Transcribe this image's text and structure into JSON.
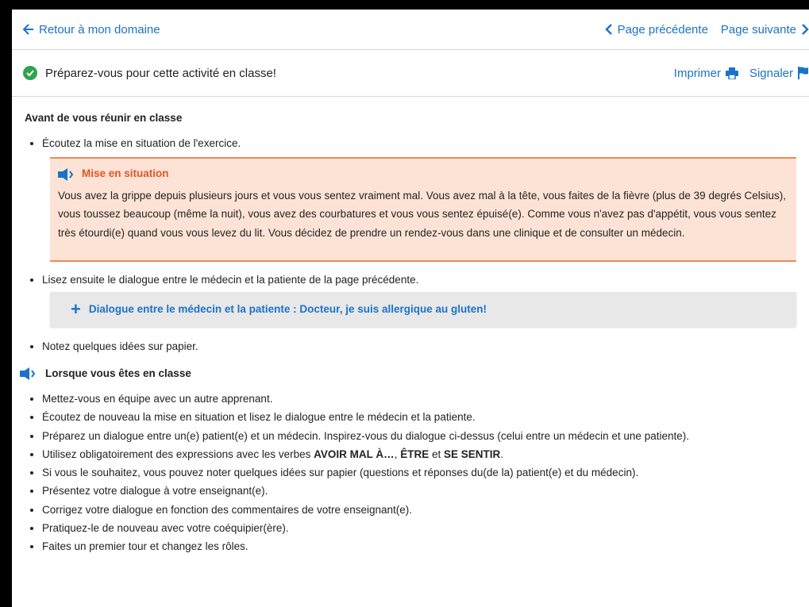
{
  "nav": {
    "back_label": "Retour à mon domaine",
    "prev_label": "Page précédente",
    "next_label": "Page suivante"
  },
  "toolbar": {
    "status_text": "Préparez-vous pour cette activité en classe!",
    "print_label": "Imprimer",
    "report_label": "Signaler"
  },
  "section1": {
    "title": "Avant de vous réunir en classe",
    "item1": "Écoutez la mise en situation de l'exercice.",
    "situation_title": "Mise en situation",
    "situation_text": "Vous avez la grippe depuis plusieurs jours et vous vous sentez vraiment mal. Vous avez mal à la tête, vous faites de la fièvre (plus de 39 degrés Celsius), vous toussez beaucoup (même la nuit), vous avez des courbatures et vous vous sentez épuisé(e). Comme vous n'avez pas d'appétit, vous vous sentez très étourdi(e) quand vous vous levez du lit. Vous décidez de prendre un rendez-vous dans une clinique et de consulter un médecin.",
    "item2": "Lisez ensuite le dialogue entre le médecin et la patiente de la page précédente.",
    "accordion_label": "Dialogue entre le médecin et la patiente : Docteur, je suis allergique au gluten!",
    "item3": "Notez quelques idées sur papier."
  },
  "section2": {
    "title": "Lorsque vous êtes en classe",
    "items": [
      "Mettez-vous en équipe avec un autre apprenant.",
      "Écoutez de nouveau la mise en situation et lisez le dialogue entre le médecin et la patiente.",
      "Préparez un dialogue entre un(e) patient(e) et un médecin. Inspirez-vous du dialogue ci-dessus (celui entre un médecin et une patiente).",
      "Si vous le souhaitez, vous pouvez noter quelques idées sur papier (questions et réponses du(de la) patient(e) et du médecin).",
      "Présentez votre dialogue à votre enseignant(e).",
      "Corrigez votre dialogue en fonction des commentaires de votre enseignant(e).",
      "Pratiquez-le de nouveau avec votre coéquipier(ère).",
      "Faites un premier tour et changez les rôles."
    ],
    "verbs_item": {
      "prefix": "Utilisez obligatoirement des expressions avec les verbes ",
      "verb1": "AVOIR MAL À…",
      "sep1": ", ",
      "verb2": "ÊTRE",
      "sep2": " et ",
      "verb3": "SE SENTIR",
      "suffix": "."
    }
  },
  "colors": {
    "link": "#1a73c9",
    "situation_bg": "#fde3d6",
    "situation_accent": "#e0552a",
    "check": "#2ea44f"
  }
}
